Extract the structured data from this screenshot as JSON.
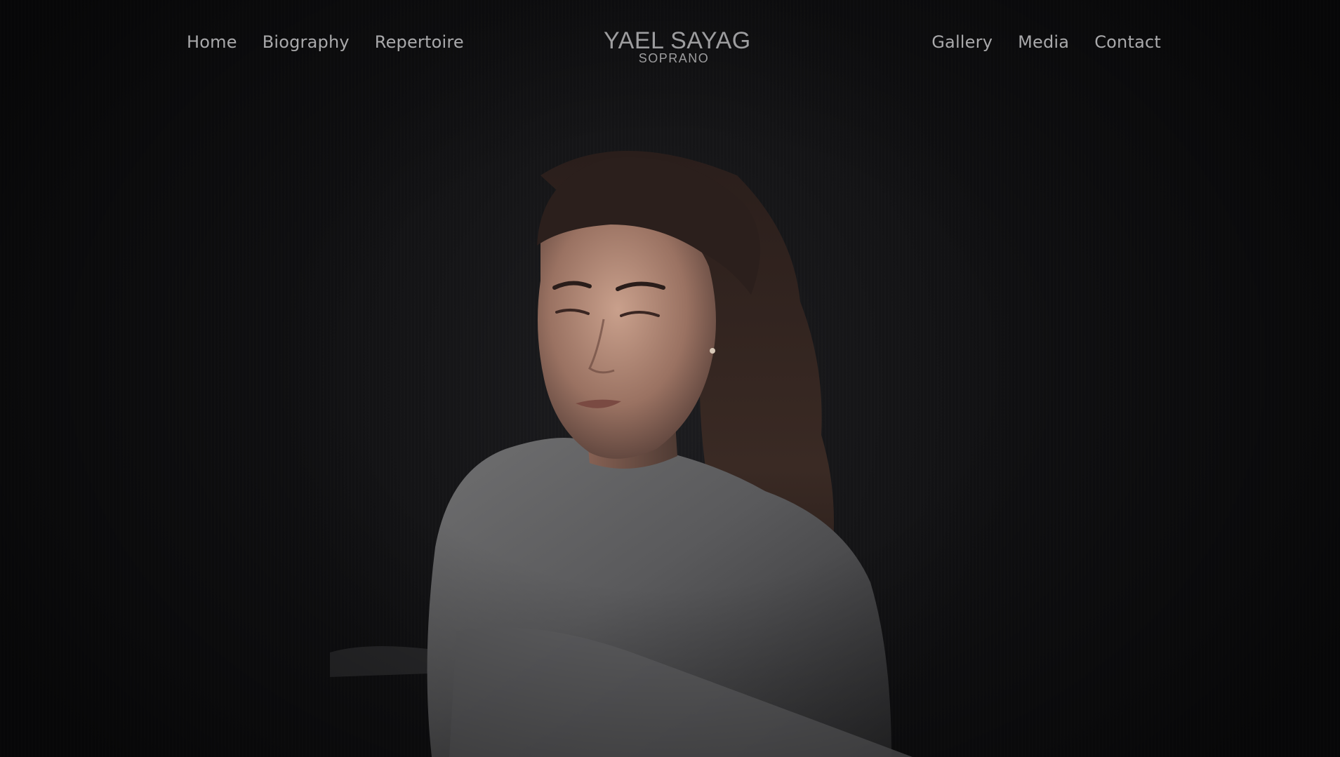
{
  "nav": {
    "left": [
      {
        "label": "Home"
      },
      {
        "label": "Biography"
      },
      {
        "label": "Repertoire"
      }
    ],
    "right": [
      {
        "label": "Gallery"
      },
      {
        "label": "Media"
      },
      {
        "label": "Contact"
      }
    ]
  },
  "logo": {
    "name": "YAEL SAYAG",
    "subtitle": "SOPRANO"
  },
  "colors": {
    "background": "#141416",
    "nav_text": "#a9a9ab",
    "logo_text": "#9d9d9f"
  }
}
